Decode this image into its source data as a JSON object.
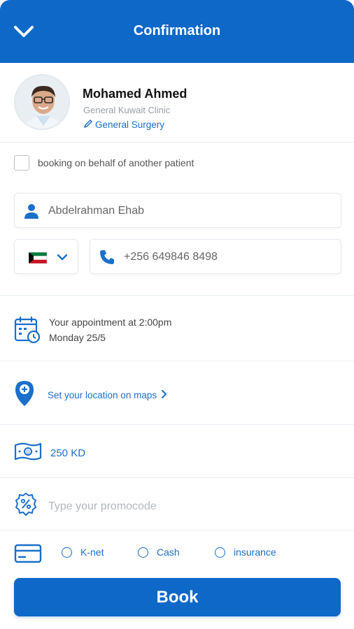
{
  "header": {
    "title": "Confirmation"
  },
  "doctor": {
    "name": "Mohamed Ahmed",
    "clinic": "General Kuwait Clinic",
    "specialty": "General Surgery"
  },
  "behalf": {
    "label": "booking on behalf of another patient",
    "checked": false
  },
  "patient": {
    "name": "Abdelrahman Ehab"
  },
  "phone": {
    "country": "Kuwait",
    "number": "+256 649846 8498"
  },
  "appointment": {
    "time_line": "Your appointment at 2:00pm",
    "date_line": "Monday 25/5"
  },
  "location": {
    "link": "Set your location on maps"
  },
  "price": {
    "value": "250 KD"
  },
  "promo": {
    "placeholder": "Type your promocode"
  },
  "payment": {
    "options": [
      {
        "label": "K-net"
      },
      {
        "label": "Cash"
      },
      {
        "label": "insurance"
      }
    ]
  },
  "book": {
    "label": "Book"
  },
  "colors": {
    "primary": "#0d68c8",
    "link": "#1a6fca",
    "muted": "#9aa0a6"
  },
  "icons": [
    "chevron-down-icon",
    "user-icon",
    "phone-icon",
    "calendar-clock-icon",
    "location-pin-icon",
    "money-icon",
    "discount-icon",
    "credit-card-icon",
    "pencil-icon",
    "chevron-right-icon"
  ]
}
